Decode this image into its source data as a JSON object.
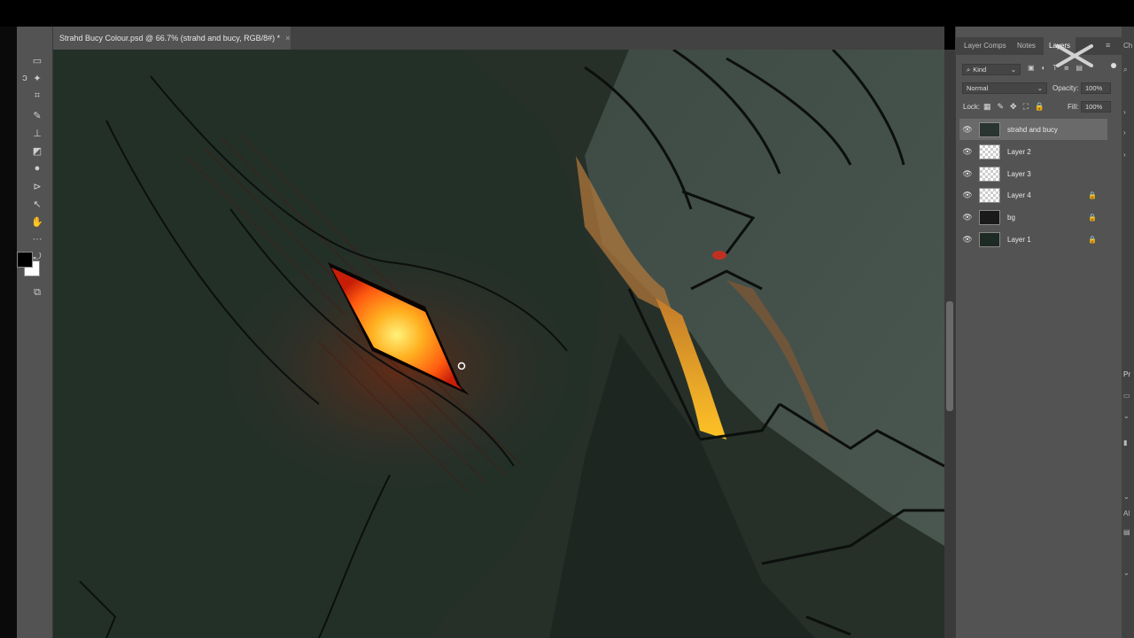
{
  "document": {
    "tab_title": "Strahd Bucy Colour.psd @ 66.7% (strahd and bucy, RGB/8#) *",
    "close_glyph": "×"
  },
  "toolbar": {
    "tools": [
      "marquee-icon",
      "lasso-icon",
      "magic-wand-icon",
      "crop-icon",
      "eyedropper-icon",
      "healing-brush-icon",
      "brush-icon",
      "clone-stamp-icon",
      "history-brush-icon",
      "eraser-icon",
      "gradient-icon",
      "blur-icon",
      "dodge-icon",
      "pen-icon",
      "path-selection-icon",
      "hand-icon",
      "more-tools-icon"
    ],
    "foreground_color": "#000000",
    "background_color": "#ffffff"
  },
  "panel": {
    "tabs": [
      {
        "label": "Layer Comps"
      },
      {
        "label": "Notes"
      },
      {
        "label": "Layers"
      }
    ],
    "filter_label": "Kind",
    "blend_mode": "Normal",
    "opacity_label": "Opacity:",
    "opacity_value": "100%",
    "lock_label": "Lock:",
    "fill_label": "Fill:",
    "fill_value": "100%",
    "layers": [
      {
        "name": "strahd and bucy",
        "selected": true,
        "locked": false,
        "thumb": "art"
      },
      {
        "name": "Layer 2",
        "selected": false,
        "locked": false,
        "thumb": "checker"
      },
      {
        "name": "Layer 3",
        "selected": false,
        "locked": false,
        "thumb": "checker"
      },
      {
        "name": "Layer 4",
        "selected": false,
        "locked": true,
        "thumb": "checker"
      },
      {
        "name": "bg",
        "selected": false,
        "locked": true,
        "thumb": "dark"
      },
      {
        "name": "Layer 1",
        "selected": false,
        "locked": true,
        "thumb": "art2"
      }
    ]
  },
  "right_strip": {
    "labels": [
      "Ch",
      "Pr",
      "Al"
    ]
  },
  "colors": {
    "ui_panel": "#535353",
    "ui_dark": "#424242",
    "canvas_bg": "#2a3430",
    "eye_glow": "#ffb020"
  }
}
